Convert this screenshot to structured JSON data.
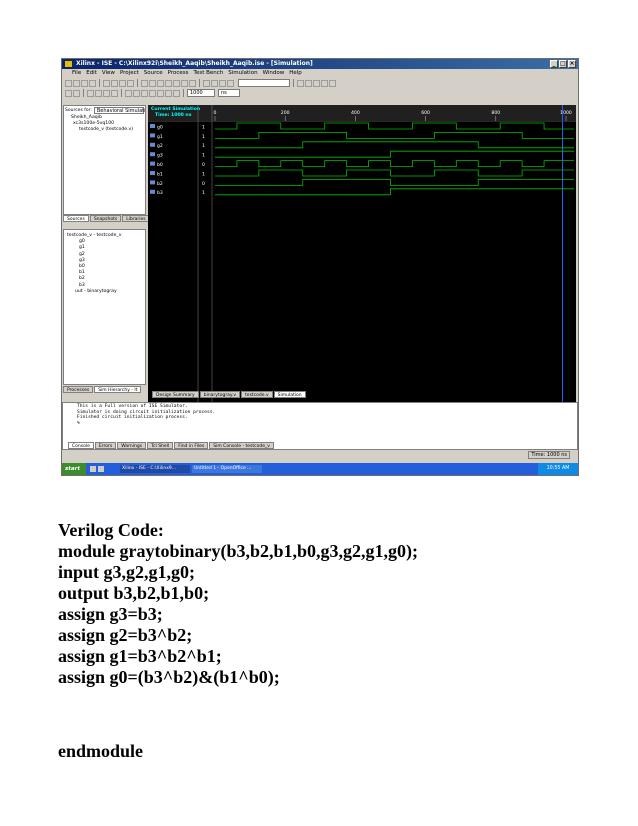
{
  "window": {
    "title": "Xilinx - ISE - C:\\Xilinx92i\\Sheikh_Aaqib\\Sheikh_Aaqib.ise - [Simulation]",
    "menu": [
      "File",
      "Edit",
      "View",
      "Project",
      "Source",
      "Process",
      "Test Bench",
      "Simulation",
      "Window",
      "Help"
    ],
    "time_value": "1000",
    "time_unit": "ns"
  },
  "sources": {
    "label": "Sources for:",
    "mode": "Behavioral Simulation",
    "tree": [
      "Sheikh_Aaqib",
      "xc3s100e-5vq100",
      "testcode_v (testcode.v)"
    ],
    "tabs": [
      "Sources",
      "Snapshots",
      "Libraries"
    ]
  },
  "hierarchy": {
    "tree": [
      "testcode_v - testcode_v",
      "g0",
      "g1",
      "g2",
      "g3",
      "b0",
      "b1",
      "b2",
      "b3",
      "uut - binarytogray"
    ],
    "tabs": [
      "Processes",
      "Sim Hierarchy - lt"
    ]
  },
  "wave": {
    "header_label": "Current Simulation",
    "header_time": "Time: 1000 ns",
    "axis_ticks": [
      "0",
      "200",
      "400",
      "600",
      "800",
      "1000"
    ],
    "signals": [
      {
        "name": "g0",
        "value": "1"
      },
      {
        "name": "g1",
        "value": "1"
      },
      {
        "name": "g2",
        "value": "1"
      },
      {
        "name": "g3",
        "value": "1"
      },
      {
        "name": "b0",
        "value": "0"
      },
      {
        "name": "b1",
        "value": "1"
      },
      {
        "name": "b2",
        "value": "0"
      },
      {
        "name": "b3",
        "value": "1"
      }
    ],
    "doc_tabs": [
      "Design Summary",
      "binarytogray.v",
      "testcode.v",
      "Simulation"
    ],
    "wave_color": "#00c000"
  },
  "console": {
    "lines": [
      "This is a Full version of ISE Simulator.",
      "Simulator is doing circuit initialization process.",
      "Finished circuit initialization process.",
      "%"
    ],
    "tabs": [
      "Console",
      "Errors",
      "Warnings",
      "Tcl Shell",
      "Find in Files",
      "Sim Console - testcode_v"
    ],
    "status": "Time: 1000 ns"
  },
  "taskbar": {
    "start": "start",
    "items": [
      "Xilinx - ISE - C:\\Xilinx9...",
      "Untitled 1 - OpenOffice ..."
    ],
    "clock": "10:55 AM"
  },
  "code": {
    "heading": "Verilog Code:",
    "lines": [
      "module graytobinary(b3,b2,b1,b0,g3,g2,g1,g0);",
      "input g3,g2,g1,g0;",
      "output b3,b2,b1,b0;",
      "assign g3=b3;",
      "assign g2=b3^b2;",
      "assign g1=b3^b2^b1;",
      "assign g0=(b3^b2)&(b1^b0);"
    ],
    "end": "endmodule"
  }
}
